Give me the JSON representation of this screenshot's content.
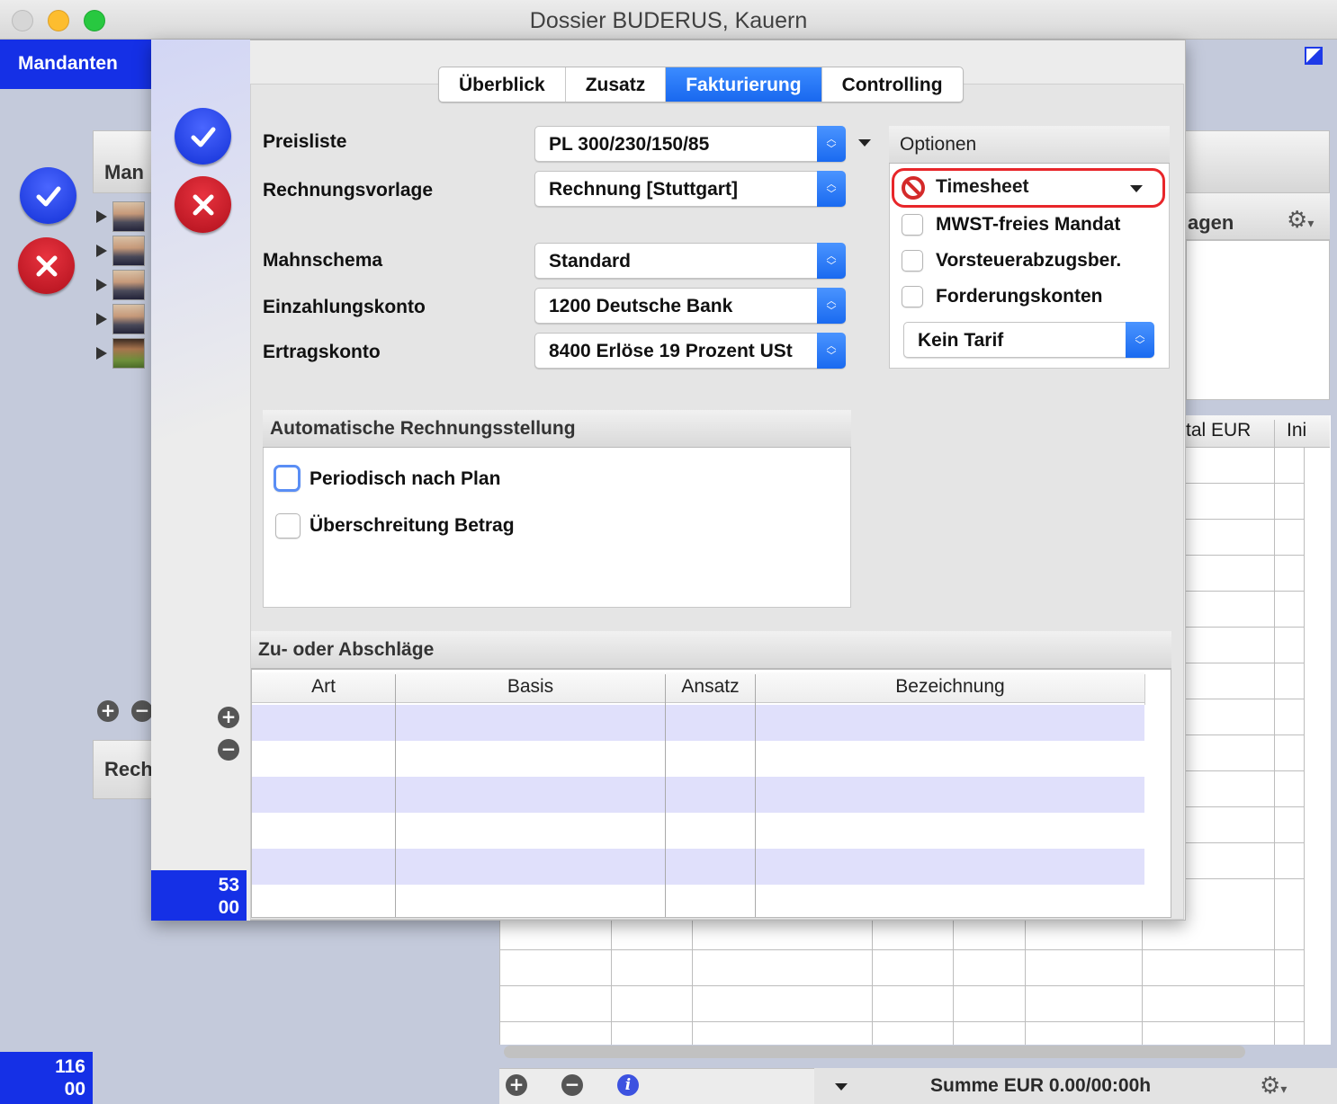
{
  "window": {
    "title": "Dossier BUDERUS, Kauern"
  },
  "sidebar": {
    "tab_label": "Mandanten",
    "counter_line1": "116",
    "counter_line2": "00"
  },
  "background": {
    "mandanten_header_partial": "Man",
    "rechnungen_header_partial": "Rech",
    "right_header_partial": "agen",
    "table_headers": [
      "tal EUR",
      "Ini"
    ],
    "summe_label": "Summe EUR 0.00/00:00h"
  },
  "sheet": {
    "counter_line1": "53",
    "counter_line2": "00",
    "tabs": [
      {
        "label": "Überblick",
        "active": false
      },
      {
        "label": "Zusatz",
        "active": false
      },
      {
        "label": "Fakturierung",
        "active": true
      },
      {
        "label": "Controlling",
        "active": false
      }
    ],
    "fields": [
      {
        "label": "Preisliste",
        "value": "PL 300/230/150/85"
      },
      {
        "label": "Rechnungsvorlage",
        "value": "Rechnung [Stuttgart]"
      },
      {
        "label": "Mahnschema",
        "value": "Standard"
      },
      {
        "label": "Einzahlungskonto",
        "value": "1200 Deutsche Bank"
      },
      {
        "label": "Ertragskonto",
        "value": "8400 Erlöse 19 Prozent USt"
      }
    ],
    "options": {
      "header": "Optionen",
      "timesheet_label": "Timesheet",
      "checkboxes": [
        {
          "label": "MWST-freies Mandat",
          "checked": false
        },
        {
          "label": "Vorsteuerabzugsber.",
          "checked": false
        },
        {
          "label": "Forderungskonten",
          "checked": false
        }
      ],
      "tarif_value": "Kein Tarif"
    },
    "auto_invoice": {
      "header": "Automatische Rechnungsstellung",
      "checkboxes": [
        {
          "label": "Periodisch nach Plan",
          "checked": false
        },
        {
          "label": "Überschreitung Betrag",
          "checked": false
        }
      ]
    },
    "adjustments": {
      "header": "Zu- oder Abschläge",
      "columns": [
        "Art",
        "Basis",
        "Ansatz",
        "Bezeichnung"
      ]
    }
  },
  "colors": {
    "accent_blue": "#1530e6",
    "tab_active": "#1766ee",
    "highlight_red": "#e8262a",
    "row_alt": "#e0e0fb"
  }
}
